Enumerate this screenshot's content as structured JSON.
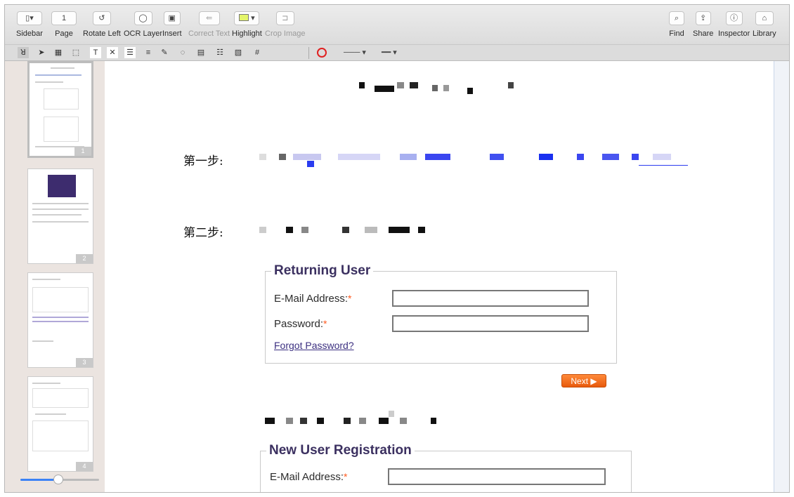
{
  "toolbar": {
    "sidebar": {
      "label": "Sidebar",
      "icon": "sidebar-toggle-icon"
    },
    "page": {
      "label": "Page",
      "value": "1"
    },
    "rotate_left": {
      "label": "Rotate Left",
      "icon": "rotate-left-icon"
    },
    "ocr": {
      "label": "OCR Layer",
      "icon": "ocr-layer-icon"
    },
    "insert": {
      "label": "Insert",
      "icon": "insert-image-icon"
    },
    "correct": {
      "label": "Correct Text",
      "icon": "correct-text-icon"
    },
    "highlight": {
      "label": "Highlight",
      "icon": "highlight-color-icon",
      "color": "#e4f56a"
    },
    "crop": {
      "label": "Crop Image",
      "icon": "crop-icon"
    },
    "find": {
      "label": "Find",
      "icon": "search-icon"
    },
    "share": {
      "label": "Share",
      "icon": "share-icon"
    },
    "inspector": {
      "label": "Inspector",
      "icon": "info-icon"
    },
    "library": {
      "label": "Library",
      "icon": "library-icon"
    }
  },
  "annotation_tools": [
    "text-selection-icon",
    "pointer-icon",
    "image-selection-icon",
    "rect-selection-icon",
    "text-annotation-icon",
    "strike-icon",
    "stamp-icon",
    "text-box-icon",
    "pen-icon",
    "comment-icon",
    "note-icon",
    "list-icon",
    "form-icon",
    "number-icon"
  ],
  "stroke": {
    "color": "#e02020"
  },
  "sidebar": {
    "pages": [
      "1",
      "2",
      "3",
      "4"
    ],
    "zoom_level": 0.42
  },
  "document": {
    "step1": "第一步:",
    "step2": "第二步:",
    "returning": {
      "legend": "Returning User",
      "email_label": "E-Mail Address:",
      "password_label": "Password:",
      "required_mark": "*",
      "forgot": "Forgot Password?",
      "next": "Next ▶"
    },
    "new_user": {
      "legend": "New User Registration",
      "email_label": "E-Mail Address:",
      "required_mark": "*"
    }
  }
}
